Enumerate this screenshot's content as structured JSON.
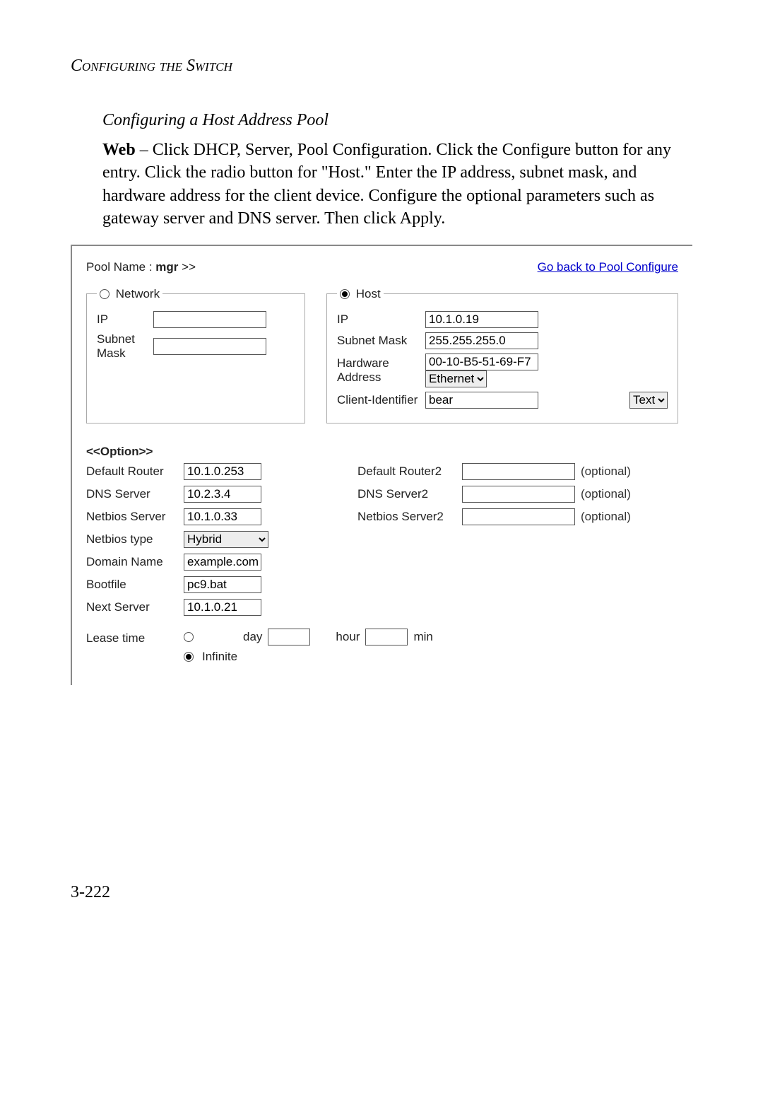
{
  "chapter_title": "Configuring the Switch",
  "section_title": "Configuring a Host Address Pool",
  "body_html": "Web – Click DHCP, Server, Pool Configuration. Click the Configure button for any entry. Click the radio button for \"Host.\" Enter the IP address, subnet mask, and hardware address for the client device. Configure the optional parameters such as gateway server and DNS server. Then click Apply.",
  "body_lead": "Web",
  "pool": {
    "label": "Pool Name :",
    "name": "mgr",
    "suffix": ">>"
  },
  "backlink": "Go back to Pool Configure",
  "mode": {
    "network": {
      "label": "Network",
      "checked": false
    },
    "host": {
      "label": "Host",
      "checked": true
    }
  },
  "network_fields": {
    "ip": {
      "label": "IP",
      "value": ""
    },
    "mask": {
      "label": "Subnet Mask",
      "value": ""
    }
  },
  "host_fields": {
    "ip": {
      "label": "IP",
      "value": "10.1.0.19"
    },
    "mask": {
      "label": "Subnet Mask",
      "value": "255.255.255.0"
    },
    "hw": {
      "label": "Hardware Address",
      "value": "00-10-B5-51-69-F7",
      "type_value": "Ethernet"
    },
    "cid": {
      "label": "Client-Identifier",
      "value": "bear",
      "type_value": "Text"
    }
  },
  "options_header": "<<Option>>",
  "options": {
    "default_router": {
      "label": "Default Router",
      "value": "10.1.0.253"
    },
    "default_router2": {
      "label": "Default Router2",
      "value": "",
      "note": "(optional)"
    },
    "dns_server": {
      "label": "DNS Server",
      "value": "10.2.3.4"
    },
    "dns_server2": {
      "label": "DNS Server2",
      "value": "",
      "note": "(optional)"
    },
    "netbios_server": {
      "label": "Netbios Server",
      "value": "10.1.0.33"
    },
    "netbios_server2": {
      "label": "Netbios Server2",
      "value": "",
      "note": "(optional)"
    },
    "netbios_type": {
      "label": "Netbios type",
      "value": "Hybrid"
    },
    "domain_name": {
      "label": "Domain Name",
      "value": "example.com"
    },
    "bootfile": {
      "label": "Bootfile",
      "value": "pc9.bat"
    },
    "next_server": {
      "label": "Next Server",
      "value": "10.1.0.21"
    }
  },
  "lease": {
    "label": "Lease time",
    "finite_checked": false,
    "infinite_checked": true,
    "infinite_label": "Infinite",
    "day_label": "day",
    "day_value": "",
    "hour_label": "hour",
    "hour_value": "",
    "min_label": "min",
    "min_value": ""
  },
  "page_number": "3-222"
}
